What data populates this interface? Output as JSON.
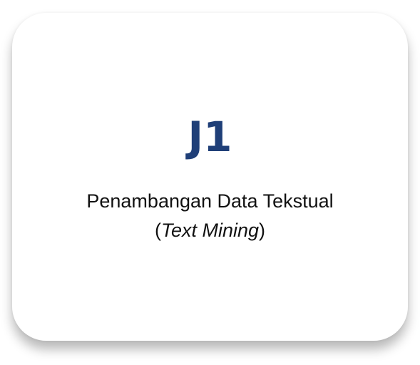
{
  "card": {
    "code": "J1",
    "title": "Penambangan Data Tekstual",
    "subtitle": "Text Mining",
    "colors": {
      "code": "#1f3f78"
    }
  }
}
